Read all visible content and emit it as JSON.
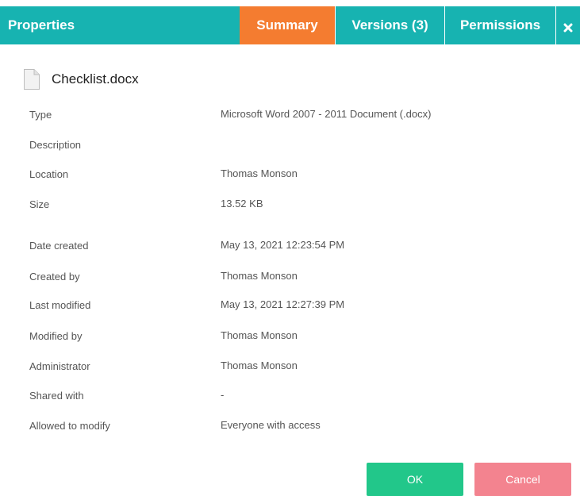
{
  "header": {
    "title": "Properties",
    "tabs": [
      "Summary",
      "Versions (3)",
      "Permissions"
    ],
    "active_tab": "Summary",
    "close_icon": "close-icon"
  },
  "file": {
    "name": "Checklist.docx",
    "icon": "document-icon"
  },
  "properties": [
    {
      "label": "Type",
      "value": "Microsoft Word 2007 - 2011 Document (.docx)"
    },
    {
      "label": "Description",
      "value": ""
    },
    {
      "label": "Location",
      "value": "Thomas Monson"
    },
    {
      "label": "Size",
      "value": "13.52 KB"
    },
    {
      "label": "Date created",
      "value": "May 13, 2021 12:23:54 PM"
    },
    {
      "label": "Created by",
      "value": "Thomas Monson"
    },
    {
      "label": "Last modified",
      "value": "May 13, 2021 12:27:39 PM"
    },
    {
      "label": "Modified by",
      "value": "Thomas Monson"
    },
    {
      "label": "Administrator",
      "value": "Thomas Monson"
    },
    {
      "label": "Shared with",
      "value": "-"
    },
    {
      "label": "Allowed to modify",
      "value": "Everyone with access"
    }
  ],
  "buttons": {
    "ok": "OK",
    "cancel": "Cancel"
  },
  "colors": {
    "header": "#17b3b1",
    "active_tab": "#f47c30",
    "ok": "#22c78a",
    "cancel": "#f3838f"
  }
}
